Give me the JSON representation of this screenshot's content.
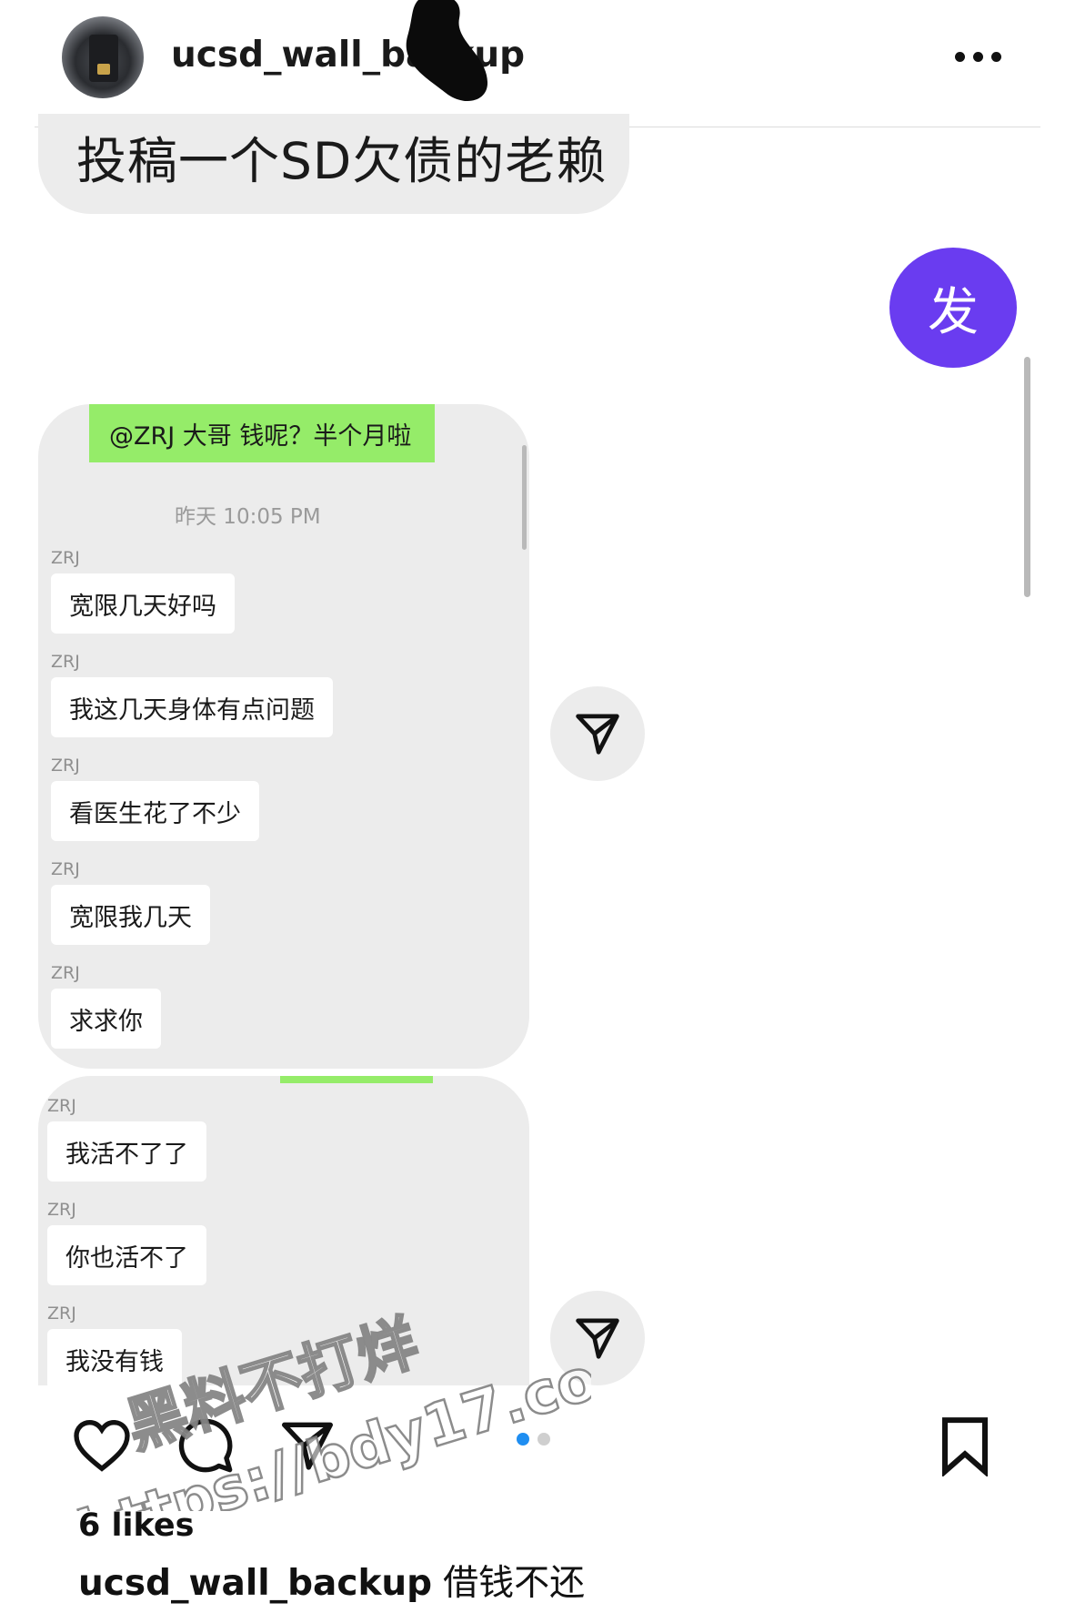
{
  "header": {
    "username": "ucsd_wall_backup",
    "more_icon": "more-horizontal-icon"
  },
  "post": {
    "title": "投稿一个SD欠债的老赖",
    "send_badge": "发",
    "chat1": {
      "outgoing": "@ZRJ 大哥 钱呢？半个月啦",
      "timestamp": "昨天 10:05 PM",
      "messages": [
        {
          "sender": "ZRJ",
          "text": "宽限几天好吗"
        },
        {
          "sender": "ZRJ",
          "text": "我这几天身体有点问题"
        },
        {
          "sender": "ZRJ",
          "text": "看医生花了不少"
        },
        {
          "sender": "ZRJ",
          "text": "宽限我几天"
        },
        {
          "sender": "ZRJ",
          "text": "求求你"
        }
      ]
    },
    "chat2": {
      "messages": [
        {
          "sender": "ZRJ",
          "text": "我活不了了"
        },
        {
          "sender": "ZRJ",
          "text": "你也活不了"
        },
        {
          "sender": "ZRJ",
          "text": "我没有钱"
        }
      ]
    }
  },
  "actions": {
    "like_icon": "heart-icon",
    "comment_icon": "comment-icon",
    "share_icon": "paper-plane-icon",
    "save_icon": "bookmark-icon",
    "carousel_total": 2,
    "carousel_active": 1,
    "accent_color": "#1f8ef1"
  },
  "watermark": {
    "line1": "黑料不打烊",
    "line2": "https://bdy17.co"
  },
  "footer": {
    "likes": "6 likes",
    "caption_user": "ucsd_wall_backup",
    "caption_text": "借钱不还"
  }
}
